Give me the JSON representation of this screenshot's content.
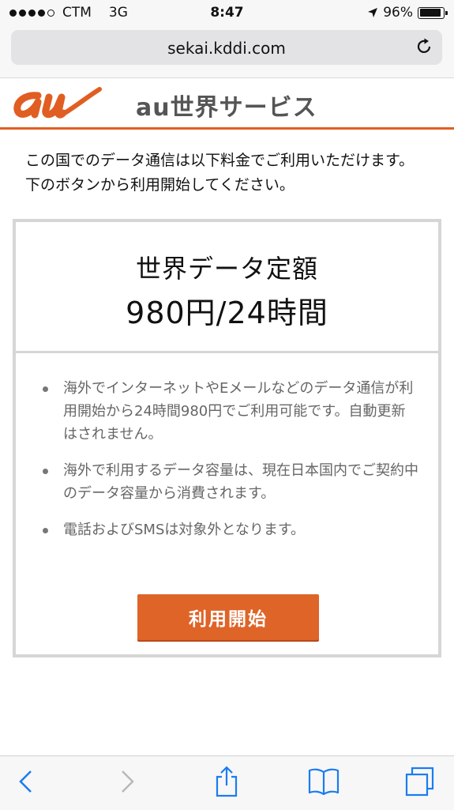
{
  "status": {
    "carrier": "CTM",
    "network": "3G",
    "time": "8:47",
    "battery": "96%",
    "signal_bars": 4,
    "battery_level": 0.96
  },
  "browser": {
    "url": "sekai.kddi.com",
    "icons": [
      "reload-icon",
      "back-icon",
      "forward-icon",
      "share-icon",
      "bookmarks-icon",
      "tabs-icon"
    ]
  },
  "header": {
    "logo": "au",
    "service_prefix": "au",
    "service_title": "世界サービス"
  },
  "intro": "この国でのデータ通信は以下料金でご利用いただけます。下のボタンから利用開始してください。",
  "plan": {
    "name": "世界データ定額",
    "price": "980円/24時間",
    "bullets": [
      "海外でインターネットやEメールなどのデータ通信が利用開始から24時間980円でご利用可能です。自動更新はされません。",
      "海外で利用するデータ容量は、現在日本国内でご契約中のデータ容量から消費されます。",
      "電話およびSMSは対象外となります。"
    ],
    "button_label": "利用開始"
  },
  "colors": {
    "accent": "#e05e22",
    "button": "#df6428",
    "border": "#d6d6d6"
  }
}
